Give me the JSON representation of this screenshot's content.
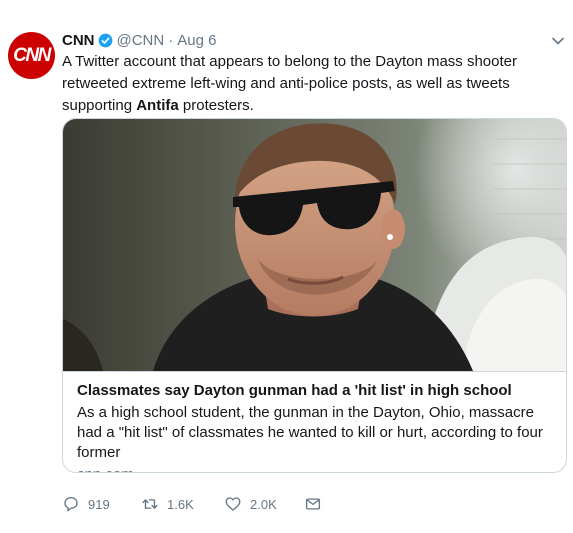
{
  "tweet": {
    "author_name": "CNN",
    "handle": "@CNN",
    "separator": "·",
    "date": "Aug 6",
    "avatar_text": "CNN",
    "text_before": "A Twitter account that appears to belong to the Dayton mass shooter retweeted extreme left-wing and anti-police posts, as well as tweets supporting ",
    "text_bold": "Antifa",
    "text_after": " protesters."
  },
  "card": {
    "title": "Classmates say Dayton gunman had a 'hit list' in high school",
    "description": "As a high school student, the gunman in the Dayton, Ohio, massacre had a \"hit list\" of classmates he wanted to kill or hurt, according to four former",
    "domain": "cnn.com"
  },
  "actions": {
    "replies": "919",
    "retweets": "1.6K",
    "likes": "2.0K"
  },
  "colors": {
    "brand_red": "#cc0000",
    "verified_blue": "#1da1f2",
    "muted": "#657786",
    "border": "#ccd6dd"
  },
  "icons": [
    "verified-badge-icon",
    "caret-down-icon",
    "reply-icon",
    "retweet-icon",
    "like-icon",
    "share-icon"
  ]
}
